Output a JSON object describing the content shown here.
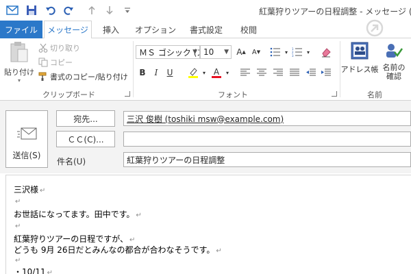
{
  "window": {
    "title": "紅葉狩りツアーの日程調整 - メッセージ (HTM"
  },
  "tabs": [
    {
      "label": "ファイル"
    },
    {
      "label": "メッセージ"
    },
    {
      "label": "挿入"
    },
    {
      "label": "オプション"
    },
    {
      "label": "書式設定"
    },
    {
      "label": "校閲"
    }
  ],
  "ribbon": {
    "clipboard": {
      "paste_label": "貼り付け",
      "cut_label": "切り取り",
      "copy_label": "コピー",
      "format_painter_label": "書式のコピー/貼り付け",
      "group_label": "クリップボード"
    },
    "font": {
      "font_name": "ＭＳ ゴシック (ス",
      "font_size": "10",
      "group_label": "フォント"
    },
    "names": {
      "address_book_label": "アドレス帳",
      "check_names_line1": "名前の",
      "check_names_line2": "確認",
      "group_label": "名前"
    }
  },
  "message": {
    "send_label": "送信(S)",
    "to_button": "宛先...",
    "cc_button": "ＣＣ(C)...",
    "subject_label": "件名(U)",
    "to_value": "三沢 俊樹 (toshiki msw@example.com)",
    "cc_value": "",
    "subject_value": "紅葉狩りツアーの日程調整"
  },
  "body": {
    "lines": [
      "三沢様",
      "",
      "お世話になってます。田中です。",
      "",
      "紅葉狩りツアーの日程ですが、",
      "どうも 9月 26日だとみんなの都合が合わなそうです。",
      "",
      "・10/11"
    ]
  },
  "colors": {
    "accent": "#2b78c9",
    "highlight_yellow": "#ffff00",
    "font_color_red": "#e81123",
    "header_bg": "#f3f3f3"
  }
}
